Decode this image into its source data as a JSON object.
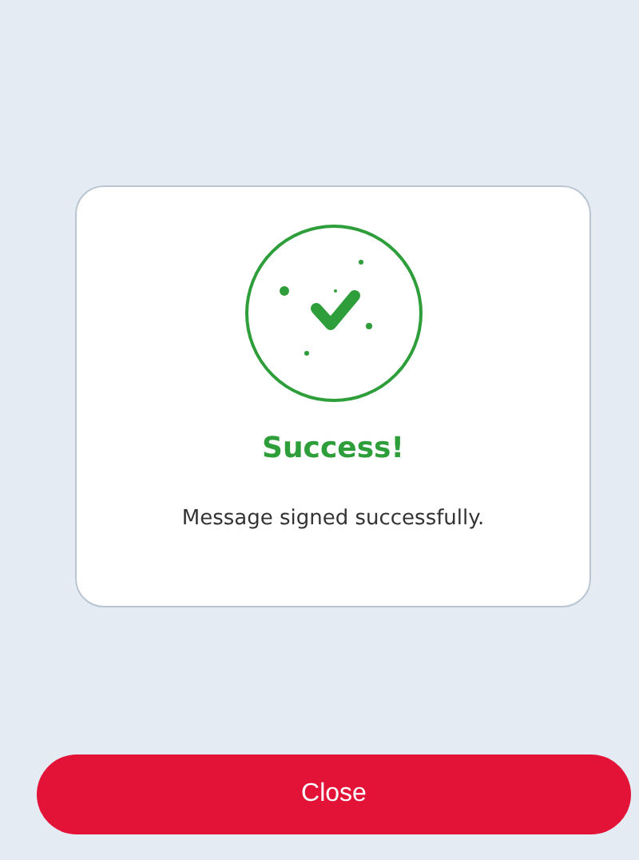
{
  "dialog": {
    "success": true,
    "title": "Success!",
    "message": "Message signed successfully."
  },
  "buttons": [
    {
      "label": "Close"
    }
  ]
}
